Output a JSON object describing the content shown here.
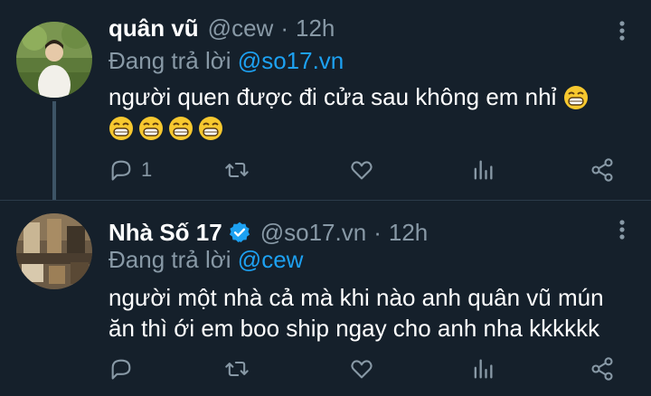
{
  "colors": {
    "background": "#15202b",
    "text_primary": "#ffffff",
    "text_secondary": "#8899a6",
    "accent": "#1da1f2",
    "thread_line": "#3d5466"
  },
  "tweets": [
    {
      "name": "quân vũ",
      "handle": "@cew",
      "dot": "·",
      "time": "12h",
      "verified": false,
      "reply_prefix": "Đang trả lời",
      "reply_to": "@so17.vn",
      "text": "người quen được đi cửa sau không em nhỉ",
      "emoji_count_inline": 1,
      "emoji_count_next_line": 4,
      "emoji_icon": "grinning-face-emoji",
      "reply_count": "1"
    },
    {
      "name": "Nhà Số 17",
      "handle": "@so17.vn",
      "dot": "·",
      "time": "12h",
      "verified": true,
      "reply_prefix": "Đang trả lời",
      "reply_to": "@cew",
      "text_line1": "người một nhà cả mà khi nào anh quân vũ mún",
      "text_line2": "ăn thì ới em boo ship ngay cho anh nha kkkkkk",
      "reply_count": ""
    }
  ]
}
